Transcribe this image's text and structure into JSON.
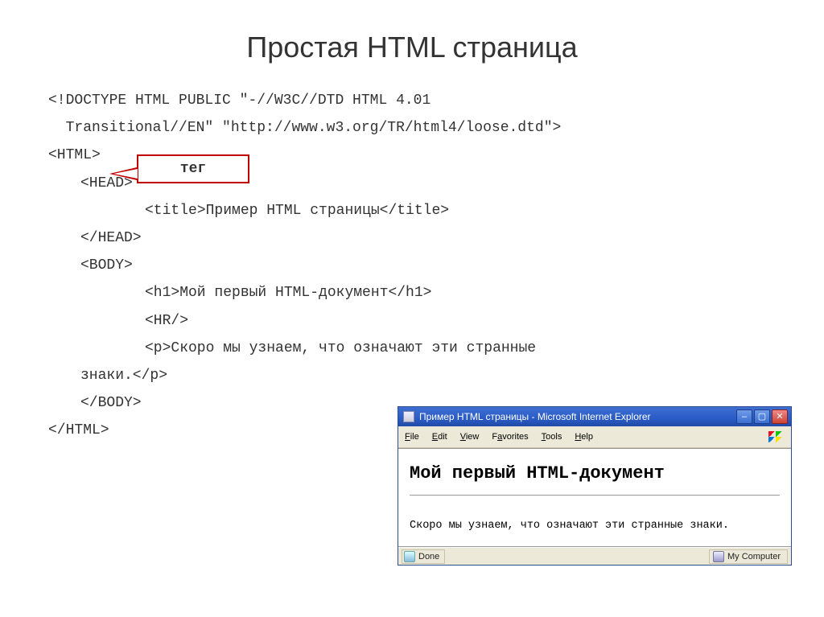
{
  "slide": {
    "title": "Простая HTML страница"
  },
  "code": {
    "line1a": "<!DOCTYPE HTML PUBLIC \"-//W3C//DTD HTML 4.01",
    "line1b": "  Transitional//EN\" \"http://www.w3.org/TR/html4/loose.dtd\">",
    "html_open": "<html>",
    "head_open": "<head>",
    "title_line": "<title>Пример HTML страницы</title>",
    "head_close": "</head>",
    "body_open": "<body>",
    "h1_line": "<h1>Мой первый HTML-документ</h1>",
    "hr_line": "<hr/>",
    "p_line_a": "<p>Скоро мы узнаем, что означают эти странные",
    "p_line_b": "знаки.</p>",
    "body_close": "</body>",
    "html_close": "</html>"
  },
  "callout": {
    "label": "тег"
  },
  "ie": {
    "title": "Пример HTML страницы - Microsoft Internet Explorer",
    "menu": {
      "file": "File",
      "edit": "Edit",
      "view": "View",
      "favorites": "Favorites",
      "tools": "Tools",
      "help": "Help"
    },
    "content": {
      "h1": "Мой первый HTML-документ",
      "p": "Скоро мы узнаем, что означают эти странные знаки."
    },
    "status": {
      "done": "Done",
      "zone": "My Computer"
    }
  }
}
